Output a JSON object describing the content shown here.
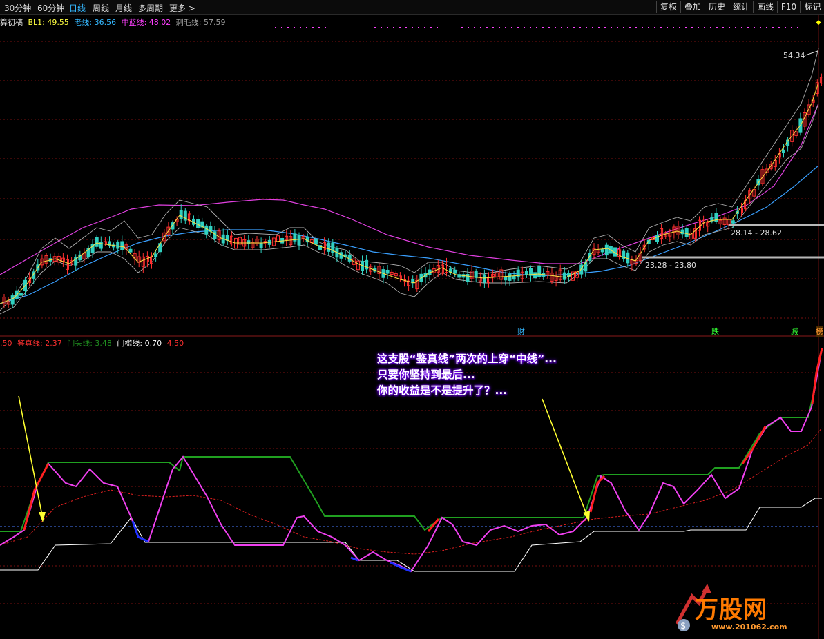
{
  "toolbar": {
    "periods": [
      "30分钟",
      "60分钟",
      "日线",
      "周线",
      "月线",
      "多周期",
      "更多 >"
    ],
    "active_period": "日线",
    "buttons": [
      "复权",
      "叠加",
      "历史",
      "统计",
      "画线",
      "F10",
      "标记"
    ]
  },
  "main_legend": {
    "name": "算初稿",
    "items": [
      {
        "label": "BL1: ",
        "value": "49.55",
        "color": "#ffff40"
      },
      {
        "label": "老线: ",
        "value": "36.56",
        "color": "#35b8ff"
      },
      {
        "label": "中蓝线: ",
        "value": "48.02",
        "color": "#ff40ff"
      },
      {
        "label": "刺毛线: ",
        "value": "57.59",
        "color": "#a0a0a0"
      }
    ]
  },
  "price_annotations": {
    "high_label": "54.34",
    "range_1": "28.14 - 28.62",
    "range_2": "23.28 - 23.80"
  },
  "event_markers": [
    {
      "text": "财",
      "color": "#35b8ff"
    },
    {
      "text": "跌",
      "color": "#33ff33"
    },
    {
      "text": "减",
      "color": "#33ff33"
    },
    {
      "text": "榜",
      "color": "#ff9933"
    }
  ],
  "sub_legend": {
    "items": [
      {
        "label": "",
        "value": ".50",
        "color": "#ff3030"
      },
      {
        "label": "鉴真线: ",
        "value": "2.37",
        "color": "#ff3030"
      },
      {
        "label": "门头线: ",
        "value": "3.48",
        "color": "#209020"
      },
      {
        "label": "门槛线: ",
        "value": "0.70",
        "color": "#ffffff"
      },
      {
        "label": "",
        "value": "4.50",
        "color": "#ff3030"
      }
    ]
  },
  "annotation": {
    "lines": [
      "这支股“鉴真线”两次的上穿“中线”...",
      "只要你坚持到最后...",
      "你的收益是不是提升了？..."
    ]
  },
  "watermark": {
    "brand": "万股网",
    "url": "www.201062.com"
  },
  "chart_data": [
    {
      "type": "candlestick",
      "title": "算初稿",
      "series": [
        {
          "name": "BL1",
          "last": 49.55
        },
        {
          "name": "老线",
          "last": 36.56
        },
        {
          "name": "中蓝线",
          "last": 48.02
        },
        {
          "name": "刺毛线",
          "last": 57.59
        }
      ],
      "annotations": [
        "54.34",
        "28.14 - 28.62",
        "23.28 - 23.80"
      ]
    },
    {
      "type": "line",
      "series": [
        {
          "name": "鉴真线",
          "last": 2.37
        },
        {
          "name": "门头线",
          "last": 3.48
        },
        {
          "name": "门槛线",
          "last": 0.7
        }
      ]
    }
  ]
}
